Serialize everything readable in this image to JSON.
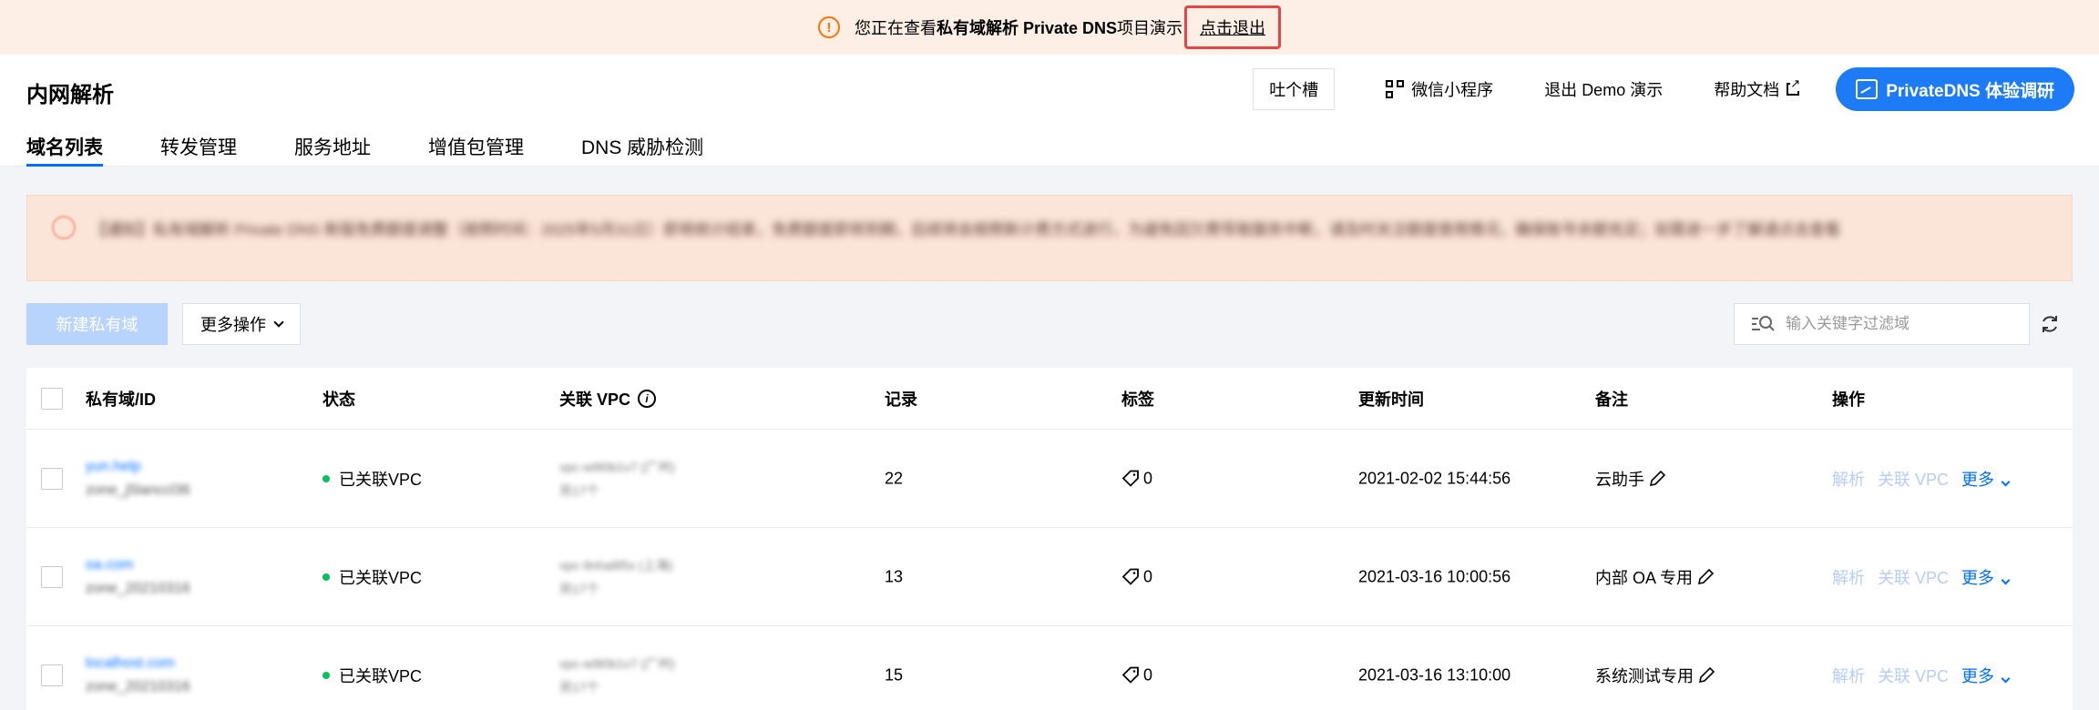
{
  "banner": {
    "prefix": "您正在查看",
    "product": "私有域解析 Private DNS",
    "suffix": "项目演示",
    "exit_link": "点击退出"
  },
  "header": {
    "title": "内网解析",
    "tabs": [
      "域名列表",
      "转发管理",
      "服务地址",
      "增值包管理",
      "DNS 威胁检测"
    ],
    "active_tab": 0,
    "tucao_label": "吐个槽",
    "wechat_label": "微信小程序",
    "exit_demo_label": "退出 Demo 演示",
    "help_label": "帮助文档",
    "survey_label": "PrivateDNS 体验调研"
  },
  "notice": {
    "text": "【通知】私有域解析 Private DNS 新版免费额度调整（按照时间：2025年5月31日）即将统计结束，免费额度即将到期，后续将会按照新计费方式进行，为避免因欠费导致服务中断，请及时关注额度使用情况，确保账号余额充足；如需进一步了解请点击查看"
  },
  "toolbar": {
    "new_zone_label": "新建私有域",
    "more_ops_label": "更多操作",
    "search_placeholder": "输入关键字过滤域"
  },
  "table": {
    "columns": [
      "私有域/ID",
      "状态",
      "关联 VPC",
      "记录",
      "标签",
      "更新时间",
      "备注",
      "操作"
    ],
    "ops": {
      "resolve": "解析",
      "link_vpc": "关联 VPC",
      "more": "更多"
    },
    "rows": [
      {
        "domain": "yun.help",
        "zone_id": "zone_j5lanccl36",
        "status": "已关联VPC",
        "vpc": "vpc-w9l0b1v7 (广州)",
        "vpc_extra": "另17个",
        "records": "22",
        "tags": "0",
        "updated": "2021-02-02 15:44:56",
        "remark": "云助手"
      },
      {
        "domain": "oa.com",
        "zone_id": "zone_20210316",
        "status": "已关联VPC",
        "vpc": "vpc-9nha8l5x (上海)",
        "vpc_extra": "另17个",
        "records": "13",
        "tags": "0",
        "updated": "2021-03-16 10:00:56",
        "remark": "内部 OA 专用"
      },
      {
        "domain": "localhost.com",
        "zone_id": "zone_20210316",
        "status": "已关联VPC",
        "vpc": "vpc-w9l0b1v7 (广州)",
        "vpc_extra": "另17个",
        "records": "15",
        "tags": "0",
        "updated": "2021-03-16 13:10:00",
        "remark": "系统测试专用"
      }
    ]
  },
  "colors": {
    "accent": "#006eff",
    "banner_bg": "#fdeee6",
    "notice_bg": "#fbe4d8",
    "status_ok": "#0abf5b"
  }
}
